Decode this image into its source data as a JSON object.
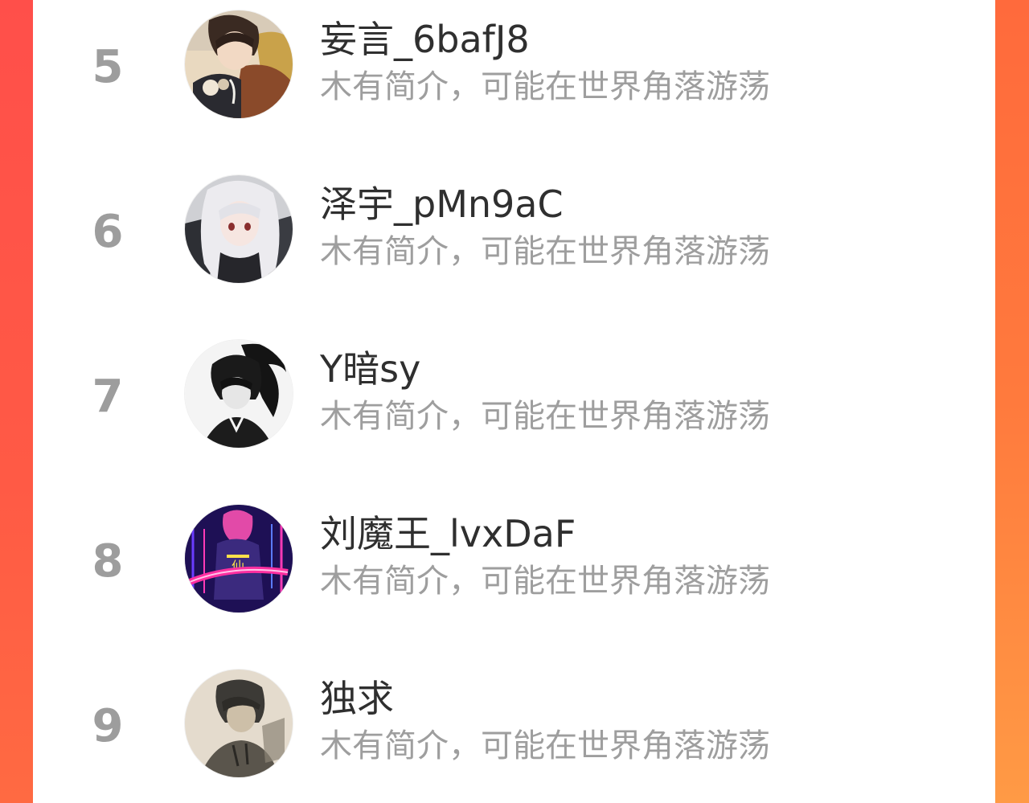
{
  "ranking": {
    "items": [
      {
        "rank": "5",
        "name": "妄言_6bafJ8",
        "bio": "木有简介，可能在世界角落游荡",
        "avatar_icon": "anime-boy-avatar-icon"
      },
      {
        "rank": "6",
        "name": "泽宇_pMn9aC",
        "bio": "木有简介，可能在世界角落游荡",
        "avatar_icon": "anime-girl-silver-hair-avatar-icon"
      },
      {
        "rank": "7",
        "name": "Y暗sy",
        "bio": "木有简介，可能在世界角落游荡",
        "avatar_icon": "monochrome-ponytail-avatar-icon"
      },
      {
        "rank": "8",
        "name": "刘魔王_lvxDaF",
        "bio": "木有简介，可能在世界角落游荡",
        "avatar_icon": "neon-cyber-avatar-icon"
      },
      {
        "rank": "9",
        "name": "独求",
        "bio": "木有简介，可能在世界角落游荡",
        "avatar_icon": "sketch-portrait-avatar-icon"
      }
    ]
  },
  "colors": {
    "background_accent": "#ff5a45",
    "rank_gray": "#9d9d9d",
    "name_text": "#2f2f2f",
    "bio_text": "#9e9e9e"
  }
}
